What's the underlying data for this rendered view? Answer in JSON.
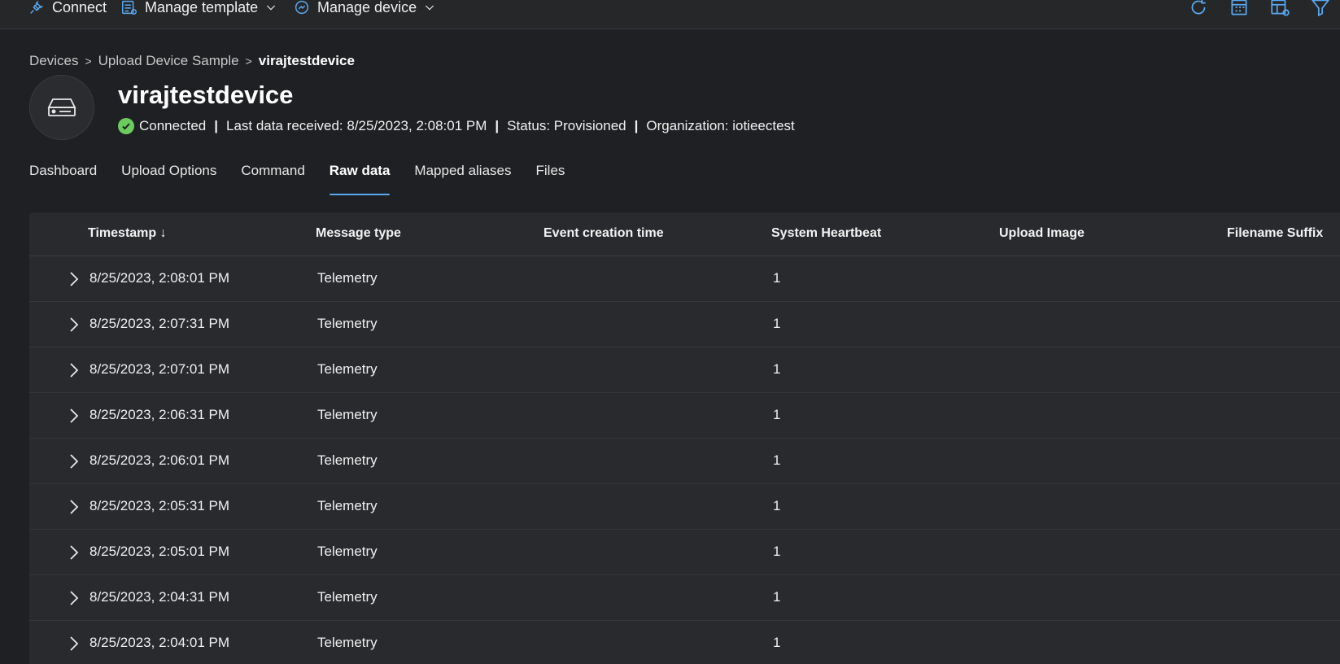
{
  "toolbar": {
    "connect_label": "Connect",
    "manage_template_label": "Manage template",
    "manage_device_label": "Manage device",
    "icons": [
      "refresh-icon",
      "calendar-icon",
      "table-settings-icon",
      "filter-icon"
    ],
    "accent_color": "#5aa9f0"
  },
  "breadcrumb": {
    "items": [
      "Devices",
      "Upload Device Sample"
    ],
    "current": "virajtestdevice"
  },
  "device": {
    "name": "virajtestdevice",
    "connection_status": "Connected",
    "last_data": "Last data received: 8/25/2023, 2:08:01 PM",
    "status": "Status: Provisioned",
    "organization": "Organization: iotieectest",
    "status_color": "#6ccb5f"
  },
  "tabs": [
    {
      "label": "Dashboard",
      "active": false
    },
    {
      "label": "Upload Options",
      "active": false
    },
    {
      "label": "Command",
      "active": false
    },
    {
      "label": "Raw data",
      "active": true
    },
    {
      "label": "Mapped aliases",
      "active": false
    },
    {
      "label": "Files",
      "active": false
    }
  ],
  "table": {
    "columns": [
      "Timestamp ↓",
      "Message type",
      "Event creation time",
      "System Heartbeat",
      "Upload Image",
      "Filename Suffix"
    ],
    "rows": [
      {
        "timestamp": "8/25/2023, 2:08:01 PM",
        "message_type": "Telemetry",
        "event_creation_time": "",
        "heartbeat": "1"
      },
      {
        "timestamp": "8/25/2023, 2:07:31 PM",
        "message_type": "Telemetry",
        "event_creation_time": "",
        "heartbeat": "1"
      },
      {
        "timestamp": "8/25/2023, 2:07:01 PM",
        "message_type": "Telemetry",
        "event_creation_time": "",
        "heartbeat": "1"
      },
      {
        "timestamp": "8/25/2023, 2:06:31 PM",
        "message_type": "Telemetry",
        "event_creation_time": "",
        "heartbeat": "1"
      },
      {
        "timestamp": "8/25/2023, 2:06:01 PM",
        "message_type": "Telemetry",
        "event_creation_time": "",
        "heartbeat": "1"
      },
      {
        "timestamp": "8/25/2023, 2:05:31 PM",
        "message_type": "Telemetry",
        "event_creation_time": "",
        "heartbeat": "1"
      },
      {
        "timestamp": "8/25/2023, 2:05:01 PM",
        "message_type": "Telemetry",
        "event_creation_time": "",
        "heartbeat": "1"
      },
      {
        "timestamp": "8/25/2023, 2:04:31 PM",
        "message_type": "Telemetry",
        "event_creation_time": "",
        "heartbeat": "1"
      },
      {
        "timestamp": "8/25/2023, 2:04:01 PM",
        "message_type": "Telemetry",
        "event_creation_time": "",
        "heartbeat": "1"
      }
    ]
  }
}
